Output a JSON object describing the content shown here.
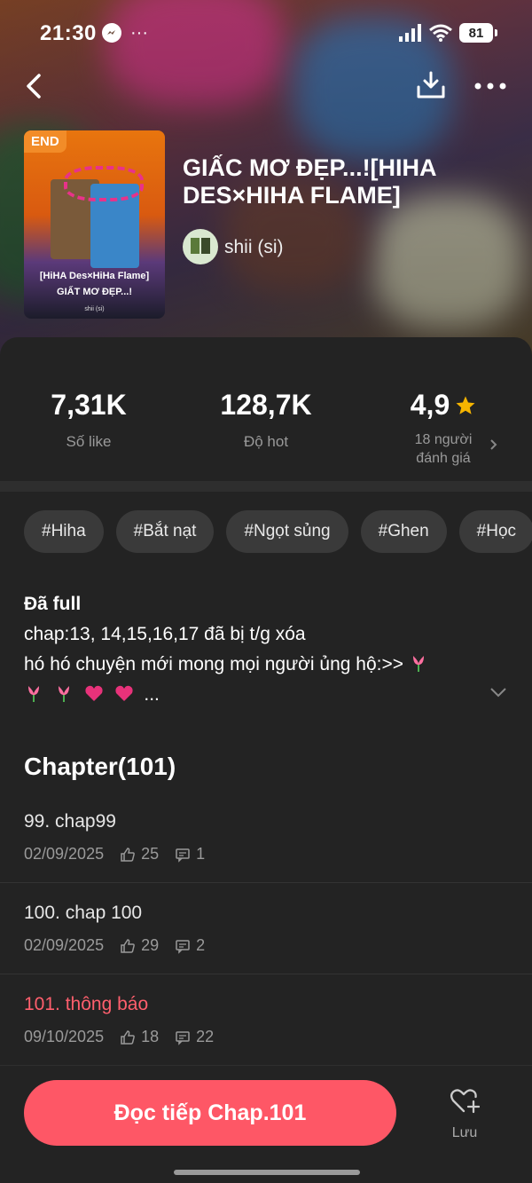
{
  "status_bar": {
    "time": "21:30",
    "battery": "81"
  },
  "novel": {
    "badge": "END",
    "title": "GIẤC MƠ ĐẸP...![HIHA DES×HIHA FLAME]",
    "author": "shii (si)",
    "cover_text_line1": "[HiHA Des×HiHa Flame]",
    "cover_text_line2": "GIẤT MƠ ĐẸP...!",
    "cover_text_line3": "shii (si)"
  },
  "stats": {
    "likes": {
      "value": "7,31K",
      "label": "Số like"
    },
    "hot": {
      "value": "128,7K",
      "label": "Độ hot"
    },
    "rating": {
      "value": "4,9",
      "label_line1": "18 người",
      "label_line2": "đánh giá"
    }
  },
  "tags": [
    "#Hiha",
    "#Bắt nạt",
    "#Ngọt sủng",
    "#Ghen",
    "#Học"
  ],
  "description": {
    "heading": "Đã full",
    "line1": "chap:13, 14,15,16,17 đã bị t/g xóa",
    "line2": "hó hó chuyện mới mong mọi người ủng hộ:>>",
    "ellipsis": "..."
  },
  "chapters": {
    "title": "Chapter(101)",
    "items": [
      {
        "name": "99. chap99",
        "date": "02/09/2025",
        "likes": "25",
        "comments": "1"
      },
      {
        "name": "100. chap 100",
        "date": "02/09/2025",
        "likes": "29",
        "comments": "2"
      },
      {
        "name": "101. thông báo",
        "date": "09/10/2025",
        "likes": "18",
        "comments": "22"
      }
    ]
  },
  "bottom": {
    "read_button": "Đọc tiếp Chap.101",
    "save_label": "Lưu"
  },
  "colors": {
    "accent": "#fe5766",
    "background": "#232323",
    "star": "#f5b400"
  }
}
